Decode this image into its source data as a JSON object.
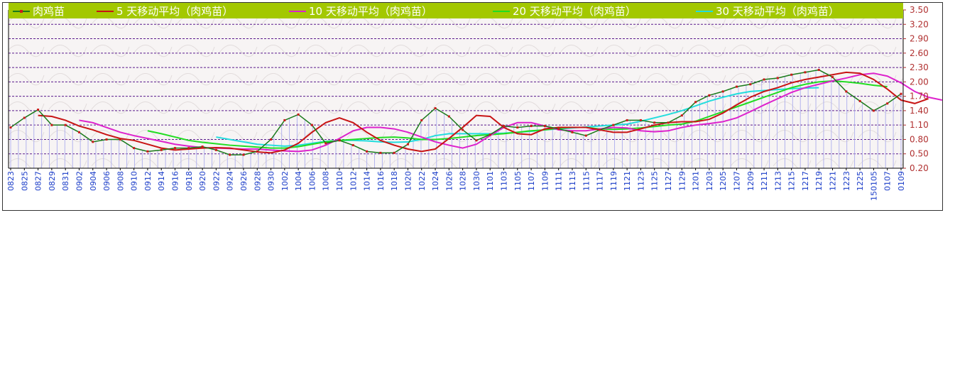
{
  "chart_data": {
    "type": "line",
    "title": "",
    "xlabel": "",
    "ylabel": "",
    "ylim": [
      0.2,
      3.5
    ],
    "yticks": [
      "3.50",
      "3.20",
      "2.90",
      "2.60",
      "2.30",
      "2.00",
      "1.70",
      "1.40",
      "1.10",
      "0.80",
      "0.50",
      "0.20"
    ],
    "x_tick_labels": [
      "0823",
      "0825",
      "0827",
      "0829",
      "0831",
      "0902",
      "0904",
      "0906",
      "0908",
      "0910",
      "0912",
      "0914",
      "0916",
      "0918",
      "0920",
      "0922",
      "0924",
      "0926",
      "0928",
      "0930",
      "1002",
      "1004",
      "1006",
      "1008",
      "1010",
      "1012",
      "1014",
      "1016",
      "1018",
      "1020",
      "1022",
      "1024",
      "1026",
      "1028",
      "1030",
      "1101",
      "1103",
      "1105",
      "1107",
      "1109",
      "1111",
      "1113",
      "1115",
      "1117",
      "1119",
      "1121",
      "1123",
      "1125",
      "1127",
      "1129",
      "1201",
      "1203",
      "1205",
      "1207",
      "1209",
      "1211",
      "1213",
      "1215",
      "1217",
      "1219",
      "1221",
      "1223",
      "1225",
      "150105",
      "0107",
      "0109"
    ],
    "grid": true,
    "legend_position": "top",
    "series": [
      {
        "name": "肉鸡苗",
        "color": "#1a7a1a",
        "marker_color": "#cc1a1a",
        "start_index": 0,
        "values": [
          1.05,
          1.25,
          1.42,
          1.1,
          1.1,
          0.95,
          0.75,
          0.8,
          0.8,
          0.62,
          0.55,
          0.58,
          0.62,
          0.62,
          0.65,
          0.58,
          0.48,
          0.48,
          0.55,
          0.8,
          1.2,
          1.32,
          1.1,
          0.72,
          0.78,
          0.68,
          0.55,
          0.52,
          0.52,
          0.7,
          1.2,
          1.45,
          1.28,
          1.0,
          0.78,
          0.9,
          1.08,
          1.05,
          1.08,
          1.08,
          1.02,
          0.95,
          0.88,
          1.0,
          1.1,
          1.2,
          1.2,
          1.15,
          1.15,
          1.3,
          1.58,
          1.72,
          1.8,
          1.9,
          1.95,
          2.05,
          2.08,
          2.15,
          2.2,
          2.25,
          2.1,
          1.8,
          1.6,
          1.4,
          1.55,
          1.75
        ]
      },
      {
        "name": "5 天移动平均（肉鸡苗）",
        "color": "#c81414",
        "start_index": 2,
        "values": [
          1.3,
          1.28,
          1.2,
          1.08,
          1.0,
          0.9,
          0.82,
          0.78,
          0.7,
          0.62,
          0.58,
          0.6,
          0.62,
          0.63,
          0.62,
          0.58,
          0.54,
          0.52,
          0.58,
          0.72,
          0.95,
          1.15,
          1.25,
          1.15,
          0.95,
          0.78,
          0.68,
          0.6,
          0.55,
          0.6,
          0.82,
          1.05,
          1.3,
          1.28,
          1.05,
          0.92,
          0.9,
          1.02,
          1.05,
          1.05,
          1.05,
          1.0,
          0.95,
          0.95,
          1.02,
          1.1,
          1.15,
          1.17,
          1.17,
          1.22,
          1.35,
          1.52,
          1.68,
          1.8,
          1.88,
          1.98,
          2.05,
          2.1,
          2.15,
          2.2,
          2.18,
          2.05,
          1.85,
          1.62,
          1.55,
          1.65
        ]
      },
      {
        "name": "10 天移动平均（肉鸡苗）",
        "color": "#dd22cc",
        "start_index": 5,
        "values": [
          1.2,
          1.15,
          1.05,
          0.95,
          0.88,
          0.82,
          0.76,
          0.7,
          0.66,
          0.63,
          0.62,
          0.61,
          0.6,
          0.6,
          0.58,
          0.56,
          0.55,
          0.58,
          0.68,
          0.82,
          0.98,
          1.05,
          1.05,
          1.02,
          0.95,
          0.85,
          0.75,
          0.68,
          0.62,
          0.7,
          0.88,
          1.05,
          1.15,
          1.15,
          1.08,
          1.0,
          0.98,
          0.98,
          1.02,
          1.05,
          1.04,
          0.98,
          0.96,
          0.98,
          1.05,
          1.1,
          1.13,
          1.17,
          1.25,
          1.38,
          1.52,
          1.65,
          1.78,
          1.88,
          1.95,
          2.02,
          2.08,
          2.15,
          2.18,
          2.12,
          1.98,
          1.8,
          1.68,
          1.62
        ]
      },
      {
        "name": "20 天移动平均（肉鸡苗）",
        "color": "#22dd22",
        "start_index": 10,
        "values": [
          0.98,
          0.92,
          0.85,
          0.78,
          0.74,
          0.71,
          0.68,
          0.66,
          0.64,
          0.62,
          0.62,
          0.65,
          0.7,
          0.75,
          0.78,
          0.8,
          0.82,
          0.84,
          0.85,
          0.83,
          0.8,
          0.8,
          0.82,
          0.85,
          0.88,
          0.9,
          0.92,
          0.95,
          0.98,
          1.0,
          1.03,
          1.05,
          1.05,
          1.02,
          1.01,
          1.02,
          1.04,
          1.07,
          1.1,
          1.12,
          1.18,
          1.28,
          1.38,
          1.48,
          1.58,
          1.68,
          1.78,
          1.88,
          1.95,
          2.0,
          2.02,
          2.0,
          1.97,
          1.93,
          1.9
        ]
      },
      {
        "name": "30 天移动平均（肉鸡苗）",
        "color": "#22dddd",
        "start_index": 15,
        "values": [
          0.85,
          0.8,
          0.75,
          0.7,
          0.68,
          0.66,
          0.68,
          0.72,
          0.76,
          0.78,
          0.78,
          0.77,
          0.75,
          0.74,
          0.75,
          0.8,
          0.88,
          0.92,
          0.92,
          0.92,
          0.92,
          0.93,
          0.95,
          0.97,
          1.0,
          1.02,
          1.04,
          1.06,
          1.08,
          1.1,
          1.12,
          1.18,
          1.25,
          1.32,
          1.4,
          1.5,
          1.6,
          1.68,
          1.75,
          1.8,
          1.82,
          1.84,
          1.86,
          1.87,
          1.88
        ]
      }
    ]
  }
}
